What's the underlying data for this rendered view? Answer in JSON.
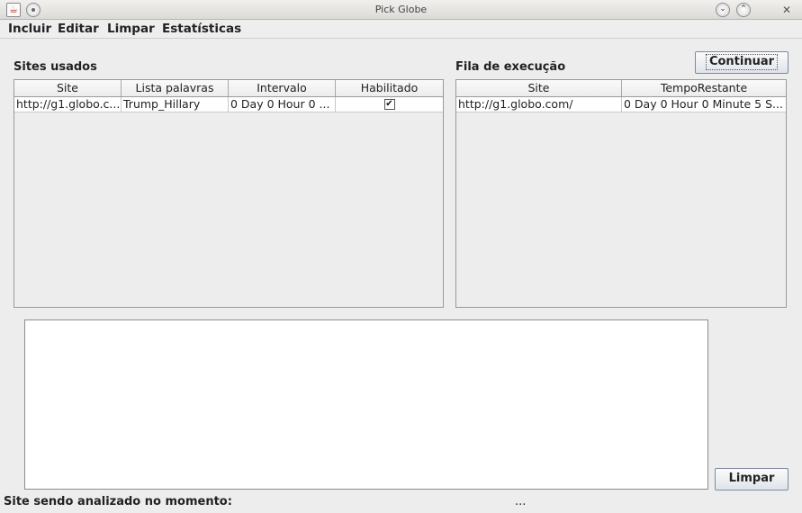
{
  "window": {
    "title": "Pick Globe",
    "java_icon_glyph": "☕",
    "minimize_glyph": "⌄",
    "maximize_glyph": "⌃",
    "close_glyph": "✕"
  },
  "menu": {
    "items": [
      "Incluir",
      "Editar",
      "Limpar",
      "Estatísticas"
    ]
  },
  "sites_panel": {
    "label": "Sites usados",
    "columns": [
      "Site",
      "Lista palavras",
      "Intervalo",
      "Habilitado"
    ],
    "rows": [
      {
        "site": "http://g1.globo.c...",
        "lista_palavras": "Trump_Hillary",
        "intervalo": "0 Day 0 Hour 0 ...",
        "habilitado": true,
        "checkmark_glyph": "✔"
      }
    ]
  },
  "queue_panel": {
    "label": "Fila de execução",
    "columns": [
      "Site",
      "TempoRestante"
    ],
    "rows": [
      {
        "site": "http://g1.globo.com/",
        "tempo_restante": "0 Day 0 Hour 0 Minute 5 S..."
      }
    ]
  },
  "buttons": {
    "continuar": "Continuar",
    "limpar": "Limpar"
  },
  "log_area": {
    "value": ""
  },
  "status": {
    "label": "Site sendo analizado no momento:",
    "value": "..."
  },
  "icons": [
    "java-icon",
    "menu-dot-icon",
    "minimize-icon",
    "maximize-icon",
    "close-icon",
    "checkbox-checked-icon"
  ]
}
